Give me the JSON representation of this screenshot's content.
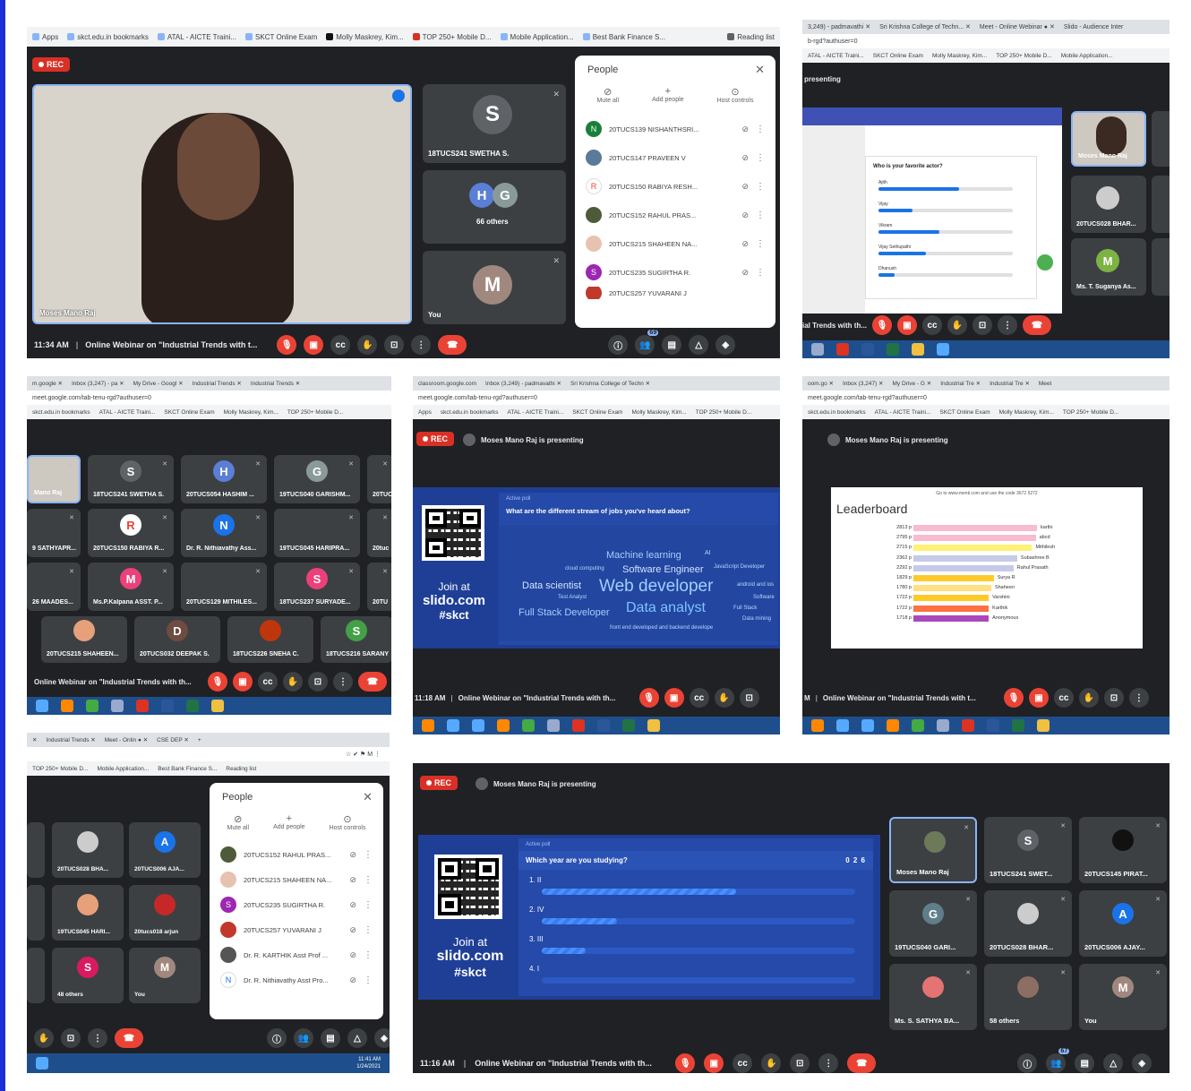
{
  "browser": {
    "apps": "Apps",
    "bm1": "skct.edu.in bookmarks",
    "bm2": "ATAL - AICTE Traini...",
    "bm3": "SKCT Online Exam",
    "bm4": "Molly Maskrey, Kim...",
    "bm5": "TOP 250+ Mobile D...",
    "bm6": "Mobile Application...",
    "bm7": "Best Bank Finance S...",
    "reading": "Reading list",
    "url": "meet.google.com/tab-tenu-rgd?authuser=0",
    "url2": "classroom.google.com"
  },
  "meet": {
    "rec": "REC",
    "title": "Online Webinar on \"Industrial Trends with t...",
    "title_b": "Online Webinar on \"Industrial Trends with th...",
    "presenting": "Moses Mano Raj is presenting",
    "time1": "11:34 AM",
    "time2": "11:18 AM",
    "time3": "11:16 AM",
    "people_title": "People",
    "mute_all": "Mute all",
    "add_people": "Add people",
    "host_controls": "Host controls",
    "you": "You",
    "others66": "66 others",
    "others48": "48 others",
    "others58": "58 others",
    "badge69": "69",
    "badge67": "67"
  },
  "p1": {
    "main_name": "Moses Mano Raj",
    "tile1": "18TUCS241 SWETHA S.",
    "tile2": "66 others",
    "people": [
      "20TUCS139 NISHANTHSRI...",
      "20TUCS147 PRAVEEN V",
      "20TUCS150 RABIYA RESH...",
      "20TUCS152 RAHUL PRAS...",
      "20TUCS215 SHAHEEN NA...",
      "20TUCS235 SUGIRTHA R.",
      "20TUCS257 YUVARANI J"
    ]
  },
  "p2": {
    "presenting": "presenting",
    "self": "Moses Mano Raj",
    "t1": "20TUCS028 BHAR...",
    "t2": "Ms. T. Suganya As...",
    "poll_q": "Who is your favorite actor?",
    "poll_opts": [
      "Ajith",
      "Vijay",
      "Vikram",
      "Vijay Sethupathi",
      "Dhanush"
    ],
    "poll_vals": [
      0.6,
      0.25,
      0.45,
      0.35,
      0.12
    ],
    "trends": "ial Trends with th..."
  },
  "p3": {
    "tiles": [
      "Mano Raj",
      "18TUCS241 SWETHA S.",
      "20TUCS054 HASHIM ...",
      "19TUCS040 GARISHM...",
      "20TUC",
      "9 SATHYAPR...",
      "20TUCS150 RABIYA R...",
      "Dr. R. Nithiavathy Ass...",
      "19TUCS045 HARIPRA...",
      "20tuc",
      "26 MAADES...",
      "Ms.P.Kalpana ASST. P...",
      "20TUCS129 MITHILES...",
      "18TUCS237 SURYADE...",
      "20TU",
      "20TUCS215 SHAHEEN...",
      "20TUCS032 DEEPAK S.",
      "18TUCS226 SNEHA C.",
      "18TUCS216 SARANY"
    ],
    "title": "Online Webinar on \"Industrial Trends with th..."
  },
  "p4": {
    "active": "Active poll",
    "question": "What are the different stream of jobs you've heard about?",
    "join1": "Join at",
    "join2": "slido.com",
    "join3": "#skct",
    "words": [
      "Machine learning",
      "AI",
      "JavaScript Developer",
      "cloud computing",
      "Software Engineer",
      "Data scientist",
      "Test Analyst",
      "Web developer",
      "android and ios",
      "Software",
      "Full Stack Developer",
      "Data analyst",
      "Full Stack",
      "Data mining",
      "front end developed and backend develope"
    ]
  },
  "p5": {
    "hint": "Go to www.menti.com and use the code 3672 5272",
    "title": "Leaderboard",
    "rows": [
      {
        "pts": "2813 p",
        "name": "karthi",
        "color": "#f8bbd0",
        "val": 1
      },
      {
        "pts": "2795 p",
        "name": "abcd",
        "color": "#f8bbd0",
        "val": 0.99
      },
      {
        "pts": "2715 p",
        "name": "Mithilesh",
        "color": "#fff176",
        "val": 0.96
      },
      {
        "pts": "2362 p",
        "name": "Subashree B",
        "color": "#c5cae9",
        "val": 0.84
      },
      {
        "pts": "2292 p",
        "name": "Rahul Prasath",
        "color": "#c5cae9",
        "val": 0.81
      },
      {
        "pts": "1829 p",
        "name": "Surya R",
        "color": "#ffca28",
        "val": 0.65
      },
      {
        "pts": "1780 p",
        "name": "Shaheen",
        "color": "#ffe082",
        "val": 0.63
      },
      {
        "pts": "1722 p",
        "name": "Varshini",
        "color": "#ffca28",
        "val": 0.61
      },
      {
        "pts": "1722 p",
        "name": "Karthik",
        "color": "#ff7043",
        "val": 0.61
      },
      {
        "pts": "1718 p",
        "name": "Anonymous",
        "color": "#ab47bc",
        "val": 0.61
      }
    ]
  },
  "p6": {
    "tiles": [
      "20TUCS028 BHA...",
      "20TUCS006 AJA...",
      "19TUCS045 HARI...",
      "20tucs018 arjun",
      "48 others",
      "You"
    ],
    "people": [
      "20TUCS152 RAHUL PRAS...",
      "20TUCS215 SHAHEEN NA...",
      "20TUCS235 SUGIRTHA R.",
      "20TUCS257 YUVARANI J",
      "Dr. R. KARTHIK Asst Prof ...",
      "Dr. R. Nithiavathy Asst Pro..."
    ],
    "clock": "11:41 AM",
    "date": "1/24/2021"
  },
  "p7": {
    "active": "Active poll",
    "question": "Which year are you studying?",
    "count": "0 2 6",
    "options": [
      {
        "label": "1.  II",
        "val": 0.62
      },
      {
        "label": "2.  IV",
        "val": 0.24
      },
      {
        "label": "3.  III",
        "val": 0.14
      },
      {
        "label": "4.  I",
        "val": 0.0
      }
    ],
    "tiles": [
      "Moses Mano Raj",
      "18TUCS241 SWET...",
      "20TUCS145 PIRAT...",
      "19TUCS040 GARI...",
      "20TUCS028 BHAR...",
      "20TUCS006 AJAY...",
      "Ms. S. SATHYA BA...",
      "58 others",
      "You"
    ]
  }
}
